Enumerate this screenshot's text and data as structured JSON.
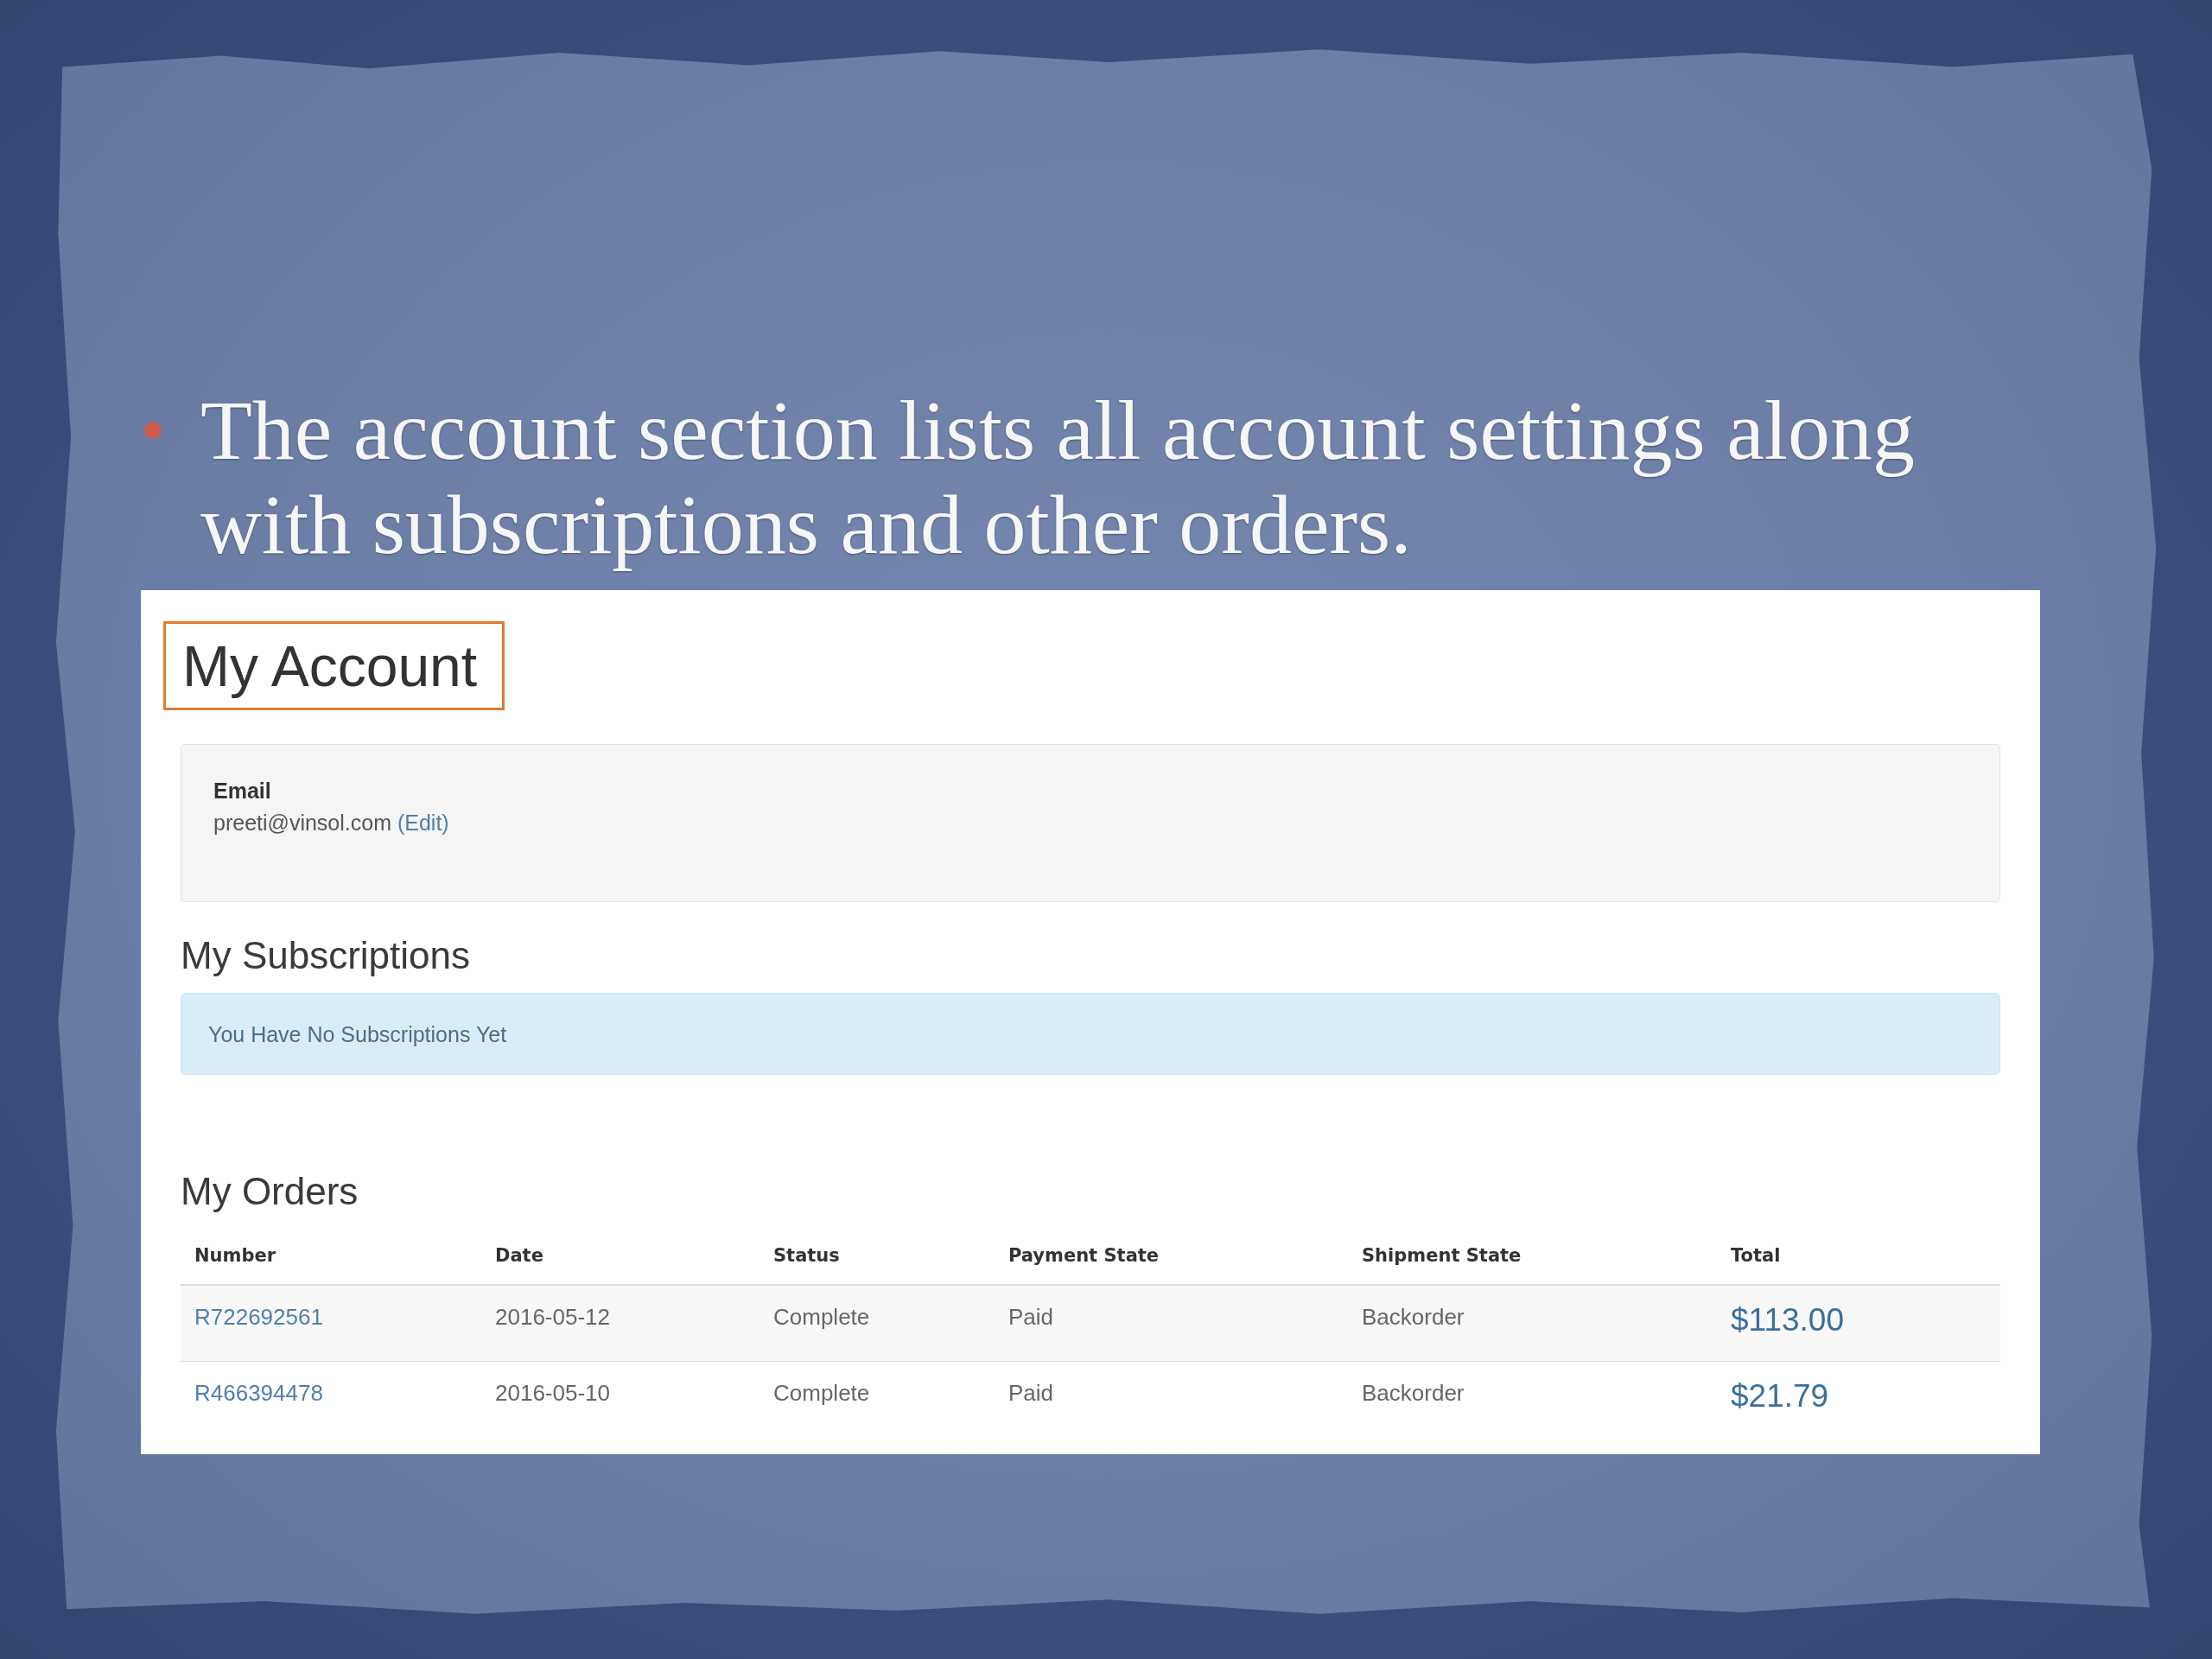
{
  "slide": {
    "bullets": [
      {
        "text": "The account section lists all account settings along with subscriptions and other orders."
      }
    ]
  },
  "screenshot": {
    "page_title": {
      "text": "My Account",
      "highlighted": true
    },
    "account": {
      "label": "Email",
      "email": "preeti@vinsol.com",
      "edit_link": "(Edit)"
    },
    "subscriptions": {
      "heading": "My Subscriptions",
      "notice": "You Have No Subscriptions Yet"
    },
    "orders": {
      "heading": "My Orders",
      "table": {
        "columns": [
          "Number",
          "Date",
          "Status",
          "Payment State",
          "Shipment State",
          "Total"
        ],
        "rows": [
          {
            "number": "R722692561",
            "date": "2016-05-12",
            "status": "Complete",
            "payment_state": "Paid",
            "shipment_state": "Backorder",
            "total": "$113.00"
          },
          {
            "number": "R466394478",
            "date": "2016-05-10",
            "status": "Complete",
            "payment_state": "Paid",
            "shipment_state": "Backorder",
            "total": "$21.79"
          }
        ]
      }
    }
  }
}
